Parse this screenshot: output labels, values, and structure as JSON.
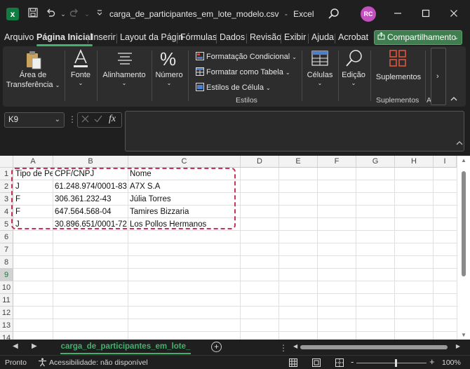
{
  "window": {
    "app_letter": "x",
    "title": "carga_de_participantes_em_lote_modelo.csv",
    "app_name": "Excel",
    "title_separator": "-",
    "avatar_initials": "RC"
  },
  "menu": {
    "tabs": [
      "Arquivo",
      "Página Inicial",
      "Inserir",
      "Layout da Págin",
      "Fórmulas",
      "Dados",
      "Revisão",
      "Exibir",
      "Ajuda",
      "Acrobat"
    ],
    "active_index": 1,
    "share_label": "Compartilhamento"
  },
  "ribbon": {
    "clipboard_label_1": "Área de",
    "clipboard_label_2": "Transferência",
    "font_label": "Fonte",
    "alignment_label": "Alinhamento",
    "number_label": "Número",
    "conditional_formatting": "Formatação Condicional",
    "format_as_table": "Formatar como Tabela",
    "cell_styles": "Estilos de Célula",
    "styles_caption": "Estilos",
    "cells_label": "Células",
    "editing_label": "Edição",
    "addins_label": "Suplementos",
    "addins_caption": "Suplementos",
    "truncated_caption": "A"
  },
  "formula_bar": {
    "name_box": "K9",
    "formula": ""
  },
  "grid": {
    "columns": [
      "A",
      "B",
      "C",
      "D",
      "E",
      "F",
      "G",
      "H",
      "I"
    ],
    "rows": [
      "1",
      "2",
      "3",
      "4",
      "5",
      "6",
      "7",
      "8",
      "9",
      "10",
      "11",
      "12",
      "13",
      "14"
    ],
    "selected_row": "9",
    "cells": [
      [
        "Tipo de Pe",
        "CPF/CNPJ",
        "Nome"
      ],
      [
        "J",
        "61.248.974/0001-83",
        "A7X S.A"
      ],
      [
        "F",
        "306.361.232-43",
        "Júlia Torres"
      ],
      [
        "F",
        "647.564.568-04",
        "Tamires Bizzaria"
      ],
      [
        "J",
        "30.896.651/0001-72",
        "Los Pollos Hermanos"
      ]
    ],
    "highlight_color": "#c8325a"
  },
  "sheets": {
    "active_tab": "carga_de_participantes_em_lote_",
    "add_symbol": "+"
  },
  "status": {
    "ready": "Pronto",
    "accessibility": "Acessibilidade: não disponível",
    "zoom": "100%",
    "zoom_minus": "-",
    "zoom_plus": "+"
  },
  "colors": {
    "accent_green": "#3fb36b",
    "excel_green": "#107c41"
  }
}
